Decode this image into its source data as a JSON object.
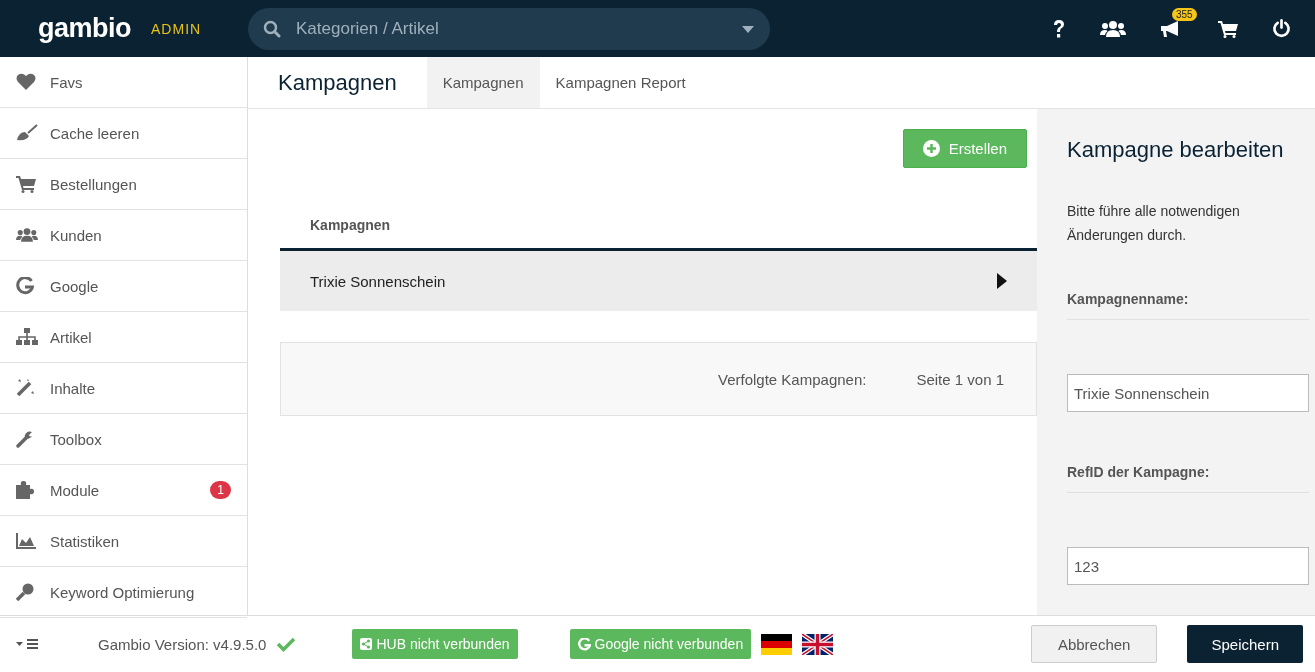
{
  "header": {
    "logo": "gambio",
    "logo_suffix": "ADMIN",
    "search": {
      "placeholder": "Kategorien / Artikel"
    },
    "notification_count": "355"
  },
  "sidebar": {
    "items": [
      {
        "label": "Favs"
      },
      {
        "label": "Cache leeren"
      },
      {
        "label": "Bestellungen"
      },
      {
        "label": "Kunden"
      },
      {
        "label": "Google"
      },
      {
        "label": "Artikel"
      },
      {
        "label": "Inhalte"
      },
      {
        "label": "Toolbox"
      },
      {
        "label": "Module",
        "badge": "1"
      },
      {
        "label": "Statistiken"
      },
      {
        "label": "Keyword Optimierung"
      }
    ]
  },
  "page": {
    "title": "Kampagnen",
    "tabs": [
      {
        "label": "Kampagnen",
        "selected": true
      },
      {
        "label": "Kampagnen Report",
        "selected": false
      }
    ],
    "create_button": "Erstellen",
    "table": {
      "columns": [
        "Kampagnen"
      ],
      "rows": [
        {
          "name": "Trixie Sonnenschein",
          "selected": true
        }
      ]
    },
    "pager": {
      "summary": "Verfolgte Kampagnen:",
      "page": "Seite 1 von 1"
    }
  },
  "edit_panel": {
    "title": "Kampagne bearbeiten",
    "description": "Bitte führe alle notwendigen Änderungen durch.",
    "fields": [
      {
        "label": "Kampagnenname:",
        "value": "Trixie Sonnenschein"
      },
      {
        "label": "RefID der Kampagne:",
        "value": "123"
      }
    ]
  },
  "footer": {
    "version": "Gambio Version: v4.9.5.0",
    "hub_button": "HUB nicht verbunden",
    "google_button": "Google nicht verbunden",
    "cancel_button": "Abbrechen",
    "save_button": "Speichern"
  }
}
